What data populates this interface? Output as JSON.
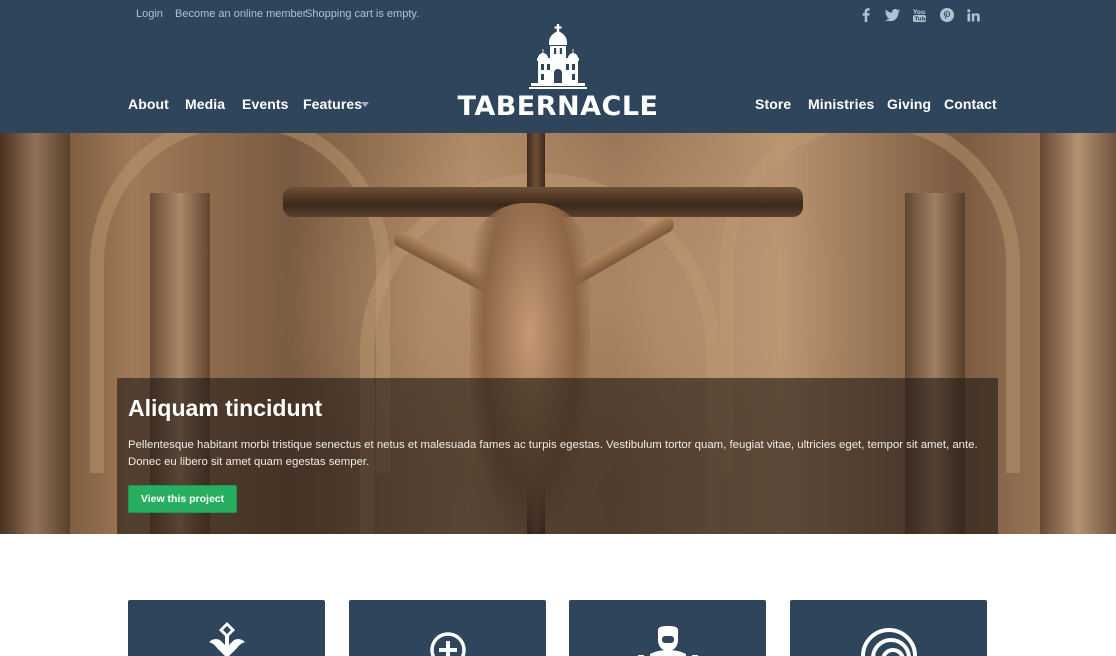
{
  "topbar": {
    "login": "Login",
    "member": "Become an online member",
    "cart": "Shopping cart is empty."
  },
  "social": [
    "facebook-icon",
    "twitter-icon",
    "youtube-icon",
    "pinterest-icon",
    "linkedin-icon"
  ],
  "nav_left": [
    "About",
    "Media",
    "Events",
    "Features"
  ],
  "nav_right": [
    "Store",
    "Ministries",
    "Giving",
    "Contact"
  ],
  "logo": {
    "text": "TABERNACLE",
    "icon": "church-icon"
  },
  "hero": {
    "title": "Aliquam tincidunt",
    "text": "Pellentesque habitant morbi tristique senectus et netus et malesuada fames ac turpis egestas. Vestibulum tortor quam, feugiat vitae, ultricies eget, tempor sit amet, ante. Donec eu libero sit amet quam egestas semper.",
    "button": "View this project"
  },
  "cards": [
    "ornate-cross-icon",
    "plus-circle-icon",
    "person-icon",
    "spiral-icon"
  ],
  "colors": {
    "header": "#2e455c",
    "button": "#27ae60",
    "white": "#ffffff"
  }
}
